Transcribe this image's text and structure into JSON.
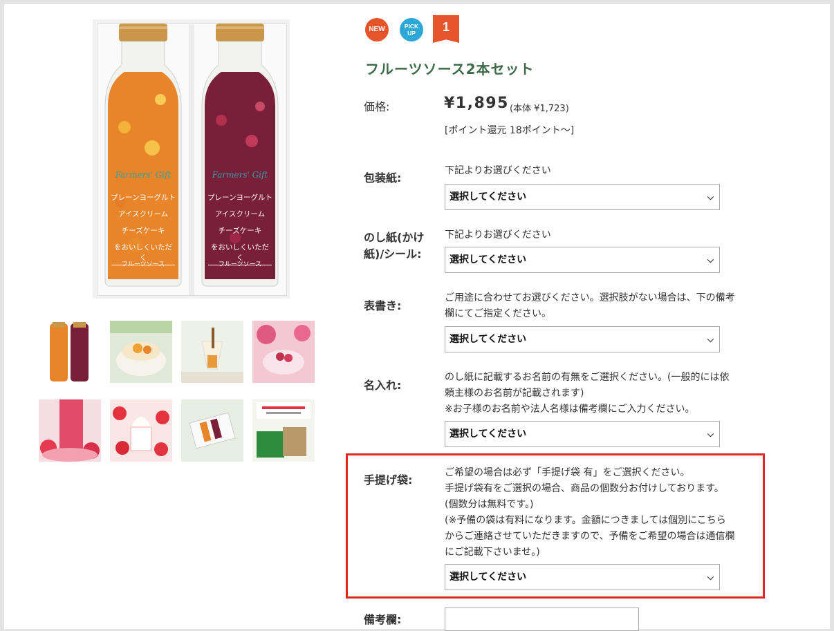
{
  "gallery": {
    "bottle_left": {
      "brand": "Farmers' Gift",
      "lines": [
        "プレーンヨーグルト",
        "アイスクリーム",
        "チーズケーキ",
        "をおいしくいただく"
      ],
      "footer": "フルーツソース"
    },
    "bottle_right": {
      "brand": "Farmers' Gift",
      "lines": [
        "プレーンヨーグルト",
        "アイスクリーム",
        "チーズケーキ",
        "をおいしくいただく"
      ],
      "footer": "フルーツソース"
    },
    "thumbnail_count": 8
  },
  "badges": {
    "new": "NEW",
    "pickup_line1": "PICK",
    "pickup_line2": "UP",
    "rank": "1"
  },
  "product": {
    "title": "フルーツソース2本セット",
    "price_label": "価格:",
    "price": "¥1,895",
    "price_tax": "(本体 ¥1,723)",
    "points": "[ポイント還元 18ポイント〜]"
  },
  "fields": {
    "wrapping": {
      "label": "包装紙:",
      "desc": "下記よりお選びください",
      "select": "選択してください"
    },
    "noshi": {
      "label_line1": "のし紙(かけ",
      "label_line2": "紙)/シール:",
      "desc": "下記よりお選びください",
      "select": "選択してください"
    },
    "omotegaki": {
      "label": "表書き:",
      "desc_line1": "ご用途に合わせてお選びください。選択肢がない場合は、下の備考",
      "desc_line2": "欄にてご指定ください。",
      "select": "選択してください"
    },
    "naire": {
      "label": "名入れ:",
      "desc_line1": "のし紙に記載するお名前の有無をご選択ください。(一般的には依",
      "desc_line2": "頼主様のお名前が記載されます)",
      "desc_line3": "※お子様のお名前や法人名様は備考欄にご入力ください。",
      "select": "選択してください"
    },
    "tesage": {
      "label": "手提げ袋:",
      "desc_line1": "ご希望の場合は必ず「手提げ袋 有」をご選択ください。",
      "desc_line2": "手提げ袋有をご選択の場合、商品の個数分お付けしております。",
      "desc_line3": "(個数分は無料です。)",
      "desc_line4": "(※予備の袋は有料になります。金額につきましては個別にこちら",
      "desc_line5": "からご連絡させていただきますので、予備をご希望の場合は通信欄",
      "desc_line6": "にご記載下さいませ。)",
      "select": "選択してください"
    },
    "memo": {
      "label": "備考欄:"
    }
  },
  "icons": {
    "select_chevron": "chevron-down-icon"
  },
  "colors": {
    "title_green": "#3d6b4a",
    "badge_orange": "#e8542a",
    "badge_blue": "#2ca8d8",
    "highlight_red": "#e02525"
  }
}
